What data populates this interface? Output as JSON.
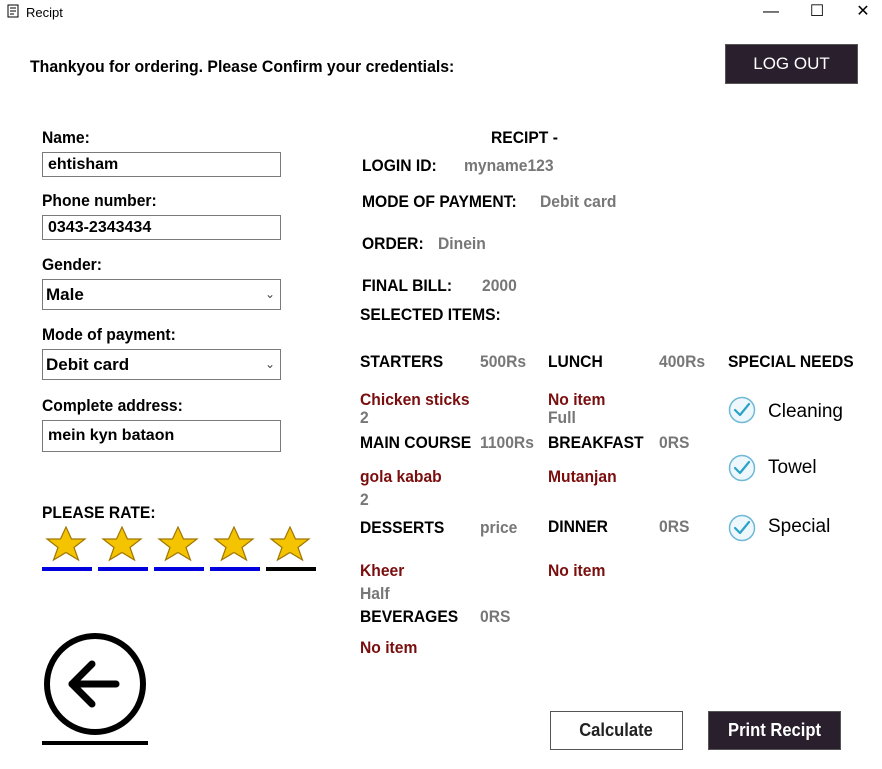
{
  "window": {
    "title": "Recipt",
    "minimize": "—",
    "maximize": "☐",
    "close": "✕"
  },
  "header": {
    "prompt": "Thankyou for ordering. Please Confirm your credentials:",
    "logout_label": "LOG OUT"
  },
  "form": {
    "name_label": "Name:",
    "name_value": "ehtisham",
    "phone_label": "Phone number:",
    "phone_value": "0343-2343434",
    "gender_label": "Gender:",
    "gender_value": "Male",
    "payment_label": "Mode of payment:",
    "payment_value": "Debit card",
    "address_label": "Complete address:",
    "address_value": "mein kyn bataon",
    "rate_label": "PLEASE RATE:",
    "rating": 5,
    "rating_max": 5
  },
  "receipt": {
    "title": "RECIPT -",
    "login_label": "LOGIN ID:",
    "login_value": "myname123",
    "mop_label": "MODE OF PAYMENT:",
    "mop_value": "Debit card",
    "order_label": "ORDER:",
    "order_value": "Dinein",
    "bill_label": "FINAL BILL:",
    "bill_value": "2000",
    "selected_label": "SELECTED ITEMS:",
    "starters": {
      "label": "STARTERS",
      "price": "500Rs",
      "item": "Chicken sticks",
      "qty": "2"
    },
    "lunch": {
      "label": "LUNCH",
      "price": "400Rs",
      "item": "No item",
      "qty": "Full"
    },
    "main_course": {
      "label": "MAIN COURSE",
      "price": "1100Rs",
      "item": "gola kabab",
      "qty": "2"
    },
    "breakfast": {
      "label": "BREAKFAST",
      "price": "0RS",
      "item": "Mutanjan"
    },
    "desserts": {
      "label": "DESSERTS",
      "price": "price",
      "item": "Kheer",
      "qty": "Half"
    },
    "dinner": {
      "label": "DINNER",
      "price": "0RS",
      "item": "No item"
    },
    "beverages": {
      "label": "BEVERAGES",
      "price": "0RS",
      "item": "No item"
    }
  },
  "special_needs": {
    "title": "SPECIAL NEEDS",
    "items": [
      "Cleaning",
      "Towel",
      "Special"
    ]
  },
  "buttons": {
    "calculate": "Calculate",
    "print": "Print Recipt"
  },
  "icons": {
    "back": "back-arrow-icon",
    "check": "check-icon",
    "star": "star-icon"
  },
  "colors": {
    "dark_button": "#2a1f2d",
    "item_red": "#7a0e0e",
    "value_gray": "#777777",
    "rating_underline": "#0000dd"
  }
}
